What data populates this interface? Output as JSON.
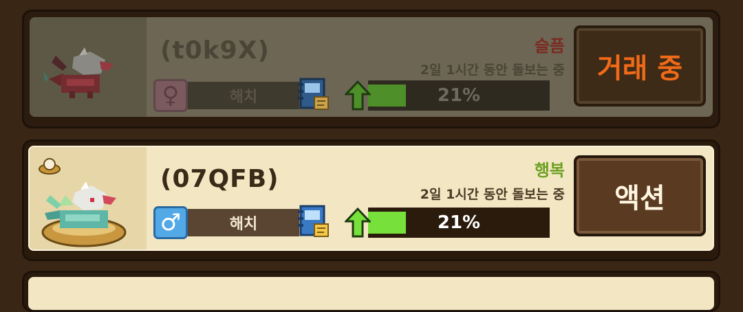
{
  "pets": [
    {
      "name": "(t0k9X)",
      "mood": "슬픔",
      "care_text": "2일 1시간 동안 돌보는 중",
      "gender_icon": "female-icon",
      "gender_symbol": "♀",
      "state": "해치",
      "growth_percent": 21,
      "growth_label": "21%",
      "action_label": "거래 중",
      "dimmed": true
    },
    {
      "name": "(07QFB)",
      "mood": "행복",
      "care_text": "2일 1시간 동안 돌보는 중",
      "gender_icon": "male-icon",
      "gender_symbol": "♂",
      "state": "해치",
      "growth_percent": 21,
      "growth_label": "21%",
      "action_label": "액션",
      "dimmed": false
    }
  ],
  "colors": {
    "background": "#3a2615",
    "mood_sad": "#7a2a20",
    "mood_happy": "#6da022",
    "trading_label": "#f06a18",
    "growth_fill": "#78e03a"
  }
}
